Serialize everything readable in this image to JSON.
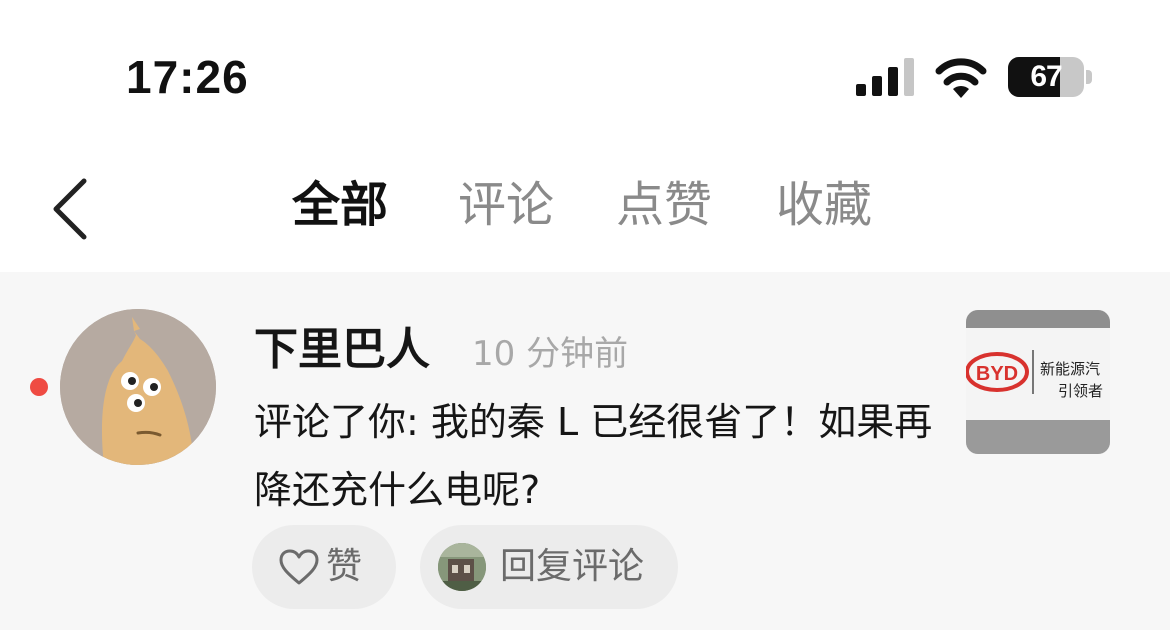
{
  "status_bar": {
    "time": "17:26",
    "battery_level": "67",
    "icons": [
      "signal-icon",
      "wifi-icon",
      "battery-icon"
    ]
  },
  "nav": {
    "back_icon": "chevron-left-icon",
    "tabs": [
      {
        "label": "全部",
        "active": true
      },
      {
        "label": "评论",
        "active": false
      },
      {
        "label": "点赞",
        "active": false
      },
      {
        "label": "收藏",
        "active": false
      }
    ]
  },
  "notification": {
    "username": "下里巴人",
    "time_ago": "10 分钟前",
    "comment": "评论了你: 我的秦 L 已经很省了！如果再降还充什么电呢?",
    "thumbnail": {
      "brand_logo": "BYD",
      "sign_line1": "新能源汽",
      "sign_line2": "引领者"
    },
    "actions": {
      "like_label": "赞",
      "reply_label": "回复评论"
    },
    "colors": {
      "unread_dot": "#ef4b43",
      "background": "#f7f7f7"
    }
  }
}
